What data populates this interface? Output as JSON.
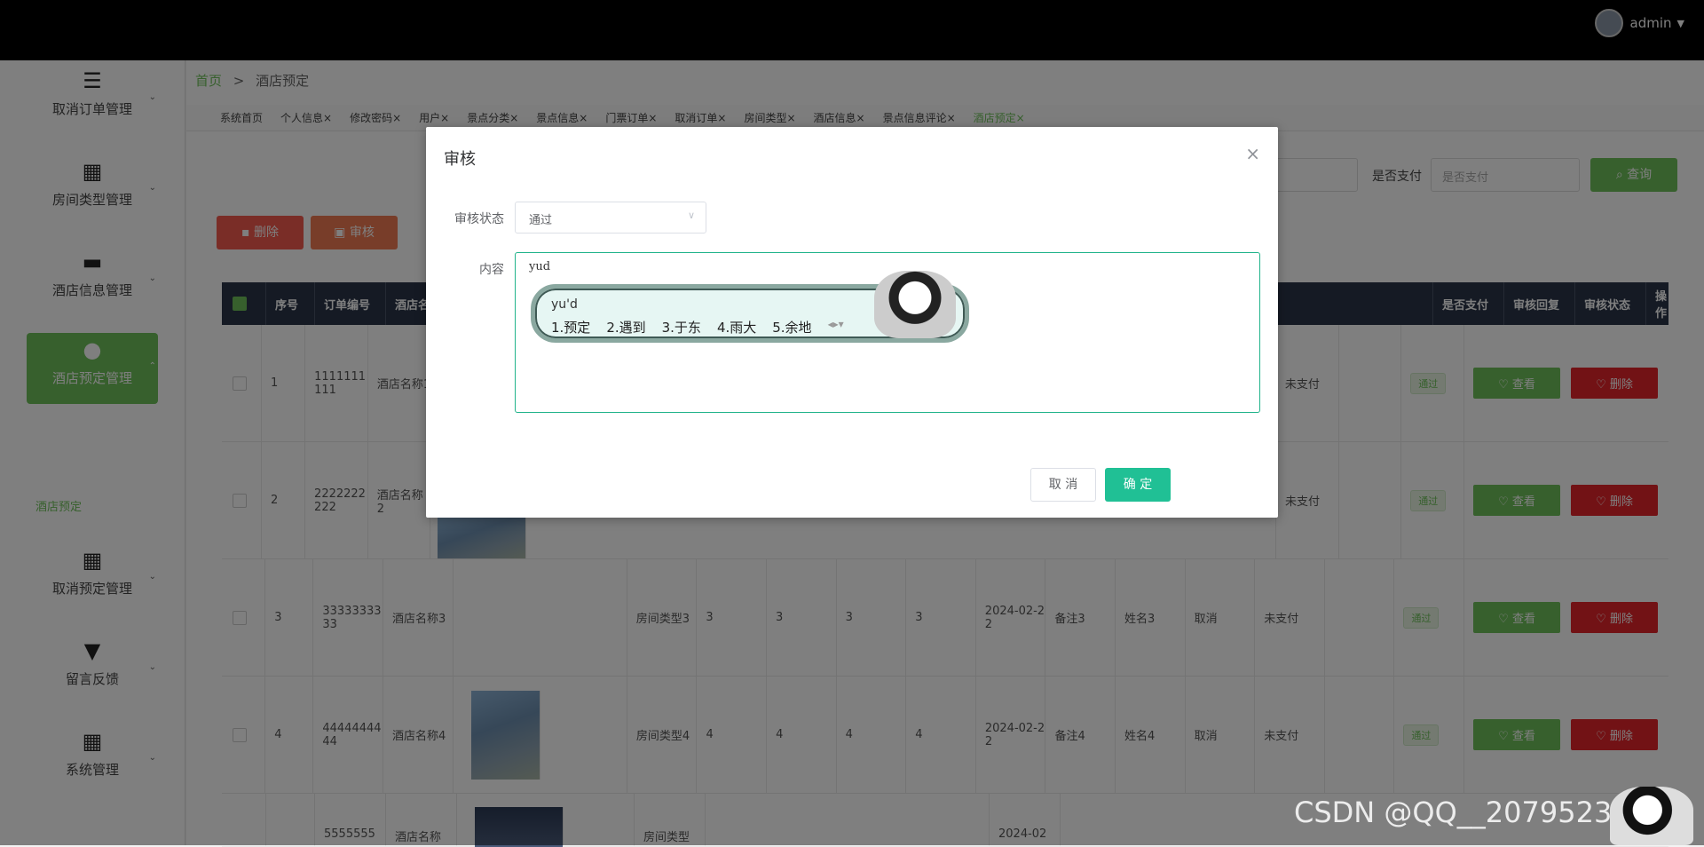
{
  "topbar": {
    "username": "admin"
  },
  "sidebar": {
    "items": [
      {
        "label": "取消订单管理",
        "icon": "list-icon"
      },
      {
        "label": "房间类型管理",
        "icon": "grid-icon"
      },
      {
        "label": "酒店信息管理",
        "icon": "hotel-icon"
      },
      {
        "label": "酒店预定管理",
        "icon": "user-icon",
        "active": true
      },
      {
        "label": "取消预定管理",
        "icon": "grid-icon"
      },
      {
        "label": "留言反馈",
        "icon": "brush-icon"
      },
      {
        "label": "系统管理",
        "icon": "grid-icon"
      }
    ],
    "submenu_label": "酒店预定"
  },
  "breadcrumb": {
    "home": "首页",
    "separator": ">",
    "current": "酒店预定"
  },
  "tabs": [
    "系统首页",
    "个人信息×",
    "修改密码×",
    "用户×",
    "景点分类×",
    "景点信息×",
    "门票订单×",
    "取消订单×",
    "房间类型×",
    "酒店信息×",
    "景点信息评论×",
    "酒店预定×"
  ],
  "search": {
    "paid_label": "是否支付",
    "paid_placeholder": "是否支付",
    "query_button": "查询"
  },
  "toolbar": {
    "delete_label": "删除",
    "audit_label": "审核"
  },
  "table": {
    "headers": [
      "序号",
      "订单编号",
      "酒店名",
      "是否支付",
      "审核回复",
      "审核状态",
      "操作"
    ],
    "rows": [
      {
        "index": "1",
        "order_no": "1111111111",
        "hotel": "酒店名称1",
        "room_type": "",
        "n1": "",
        "n2": "",
        "n3": "",
        "n4": "",
        "date": "",
        "remark": "",
        "name": "",
        "status": "",
        "paid": "未支付",
        "audit": "通过"
      },
      {
        "index": "2",
        "order_no": "2222222222",
        "hotel": "酒店名称2",
        "room_type": "",
        "n1": "",
        "n2": "",
        "n3": "",
        "n4": "",
        "date": "",
        "remark": "",
        "name": "",
        "status": "",
        "paid": "未支付",
        "audit": "通过"
      },
      {
        "index": "3",
        "order_no": "3333333333",
        "hotel": "酒店名称3",
        "room_type": "房间类型3",
        "n1": "3",
        "n2": "3",
        "n3": "3",
        "n4": "3",
        "date": "2024-02-22",
        "remark": "备注3",
        "name": "姓名3",
        "status": "取消",
        "paid": "未支付",
        "audit": "通过"
      },
      {
        "index": "4",
        "order_no": "4444444444",
        "hotel": "酒店名称4",
        "room_type": "房间类型4",
        "n1": "4",
        "n2": "4",
        "n3": "4",
        "n4": "4",
        "date": "2024-02-22",
        "remark": "备注4",
        "name": "姓名4",
        "status": "取消",
        "paid": "未支付",
        "audit": "通过"
      },
      {
        "index": "5",
        "order_no": "5555555",
        "hotel": "酒店名称",
        "room_type": "房间类型",
        "n1": "",
        "n2": "",
        "n3": "",
        "n4": "",
        "date": "2024-02",
        "remark": "",
        "name": "",
        "status": "",
        "paid": "",
        "audit": ""
      }
    ],
    "view_label": "查看",
    "delete_label": "删除"
  },
  "dialog": {
    "title": "审核",
    "status_label": "审核状态",
    "status_value": "通过",
    "content_label": "内容",
    "content_value": "yud",
    "cancel_label": "取 消",
    "ok_label": "确 定"
  },
  "ime": {
    "input": "yu'd",
    "candidates": [
      "1.预定",
      "2.遇到",
      "3.于东",
      "4.雨大",
      "5.余地"
    ]
  },
  "watermark": "CSDN @QQ__2079523389"
}
